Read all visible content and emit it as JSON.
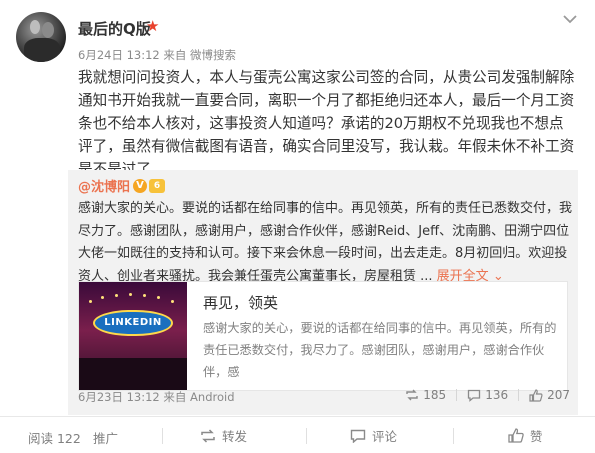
{
  "post": {
    "author": "最后的Q版",
    "vip_badge": "★",
    "meta": "6月24日 13:12 来自 微博搜索",
    "text": "我就想问问投资人，本人与蛋壳公寓这家公司签的合同，从贵公司发强制解除通知书开始我就一直要合同，离职一个月了都拒绝归还本人，最后一个月工资条也不给本人核对，这事投资人知道吗？承诺的20万期权不兑现我也不想点评了，虽然有微信截图有语音，确实合同里没写，我认栽。年假未休不补工资是不是过了"
  },
  "repost": {
    "author": "@沈博阳",
    "badge_v": "V",
    "badge_level": "6",
    "text": "感谢大家的关心。要说的话都在给同事的信中。再见领英，所有的责任已悉数交付，我尽力了。感谢团队，感谢用户，感谢合作伙伴，感谢Reid、Jeff、沈南鹏、田溯宁四位大佬一如既往的支持和认可。接下来会休息一段时间，出去走走。8月初回归。欢迎投资人、创业者来骚扰。我会兼任蛋壳公寓董事长，房屋租赁 ...",
    "expand_label": "展开全文",
    "expand_icon": "⌄",
    "card": {
      "image_text": "LINKEDIN",
      "title": "再见，领英",
      "desc": "感谢大家的关心，要说的话都在给同事的信中。再见领英，所有的责任已悉数交付，我尽力了。感谢团队，感谢用户，感谢合作伙伴，感"
    },
    "time": "6月23日 13:12 来自 Android",
    "reposts": "185",
    "comments": "136",
    "likes": "207"
  },
  "actions": {
    "reads": "阅读 122",
    "promote": "推广",
    "repost": "转发",
    "comment": "评论",
    "like": "赞"
  },
  "colors": {
    "accent": "#eb7350",
    "vip_star": "#e8412c",
    "repost_bg": "#f2f2f2"
  },
  "icons": [
    "chevron-down-icon",
    "vip-star-icon",
    "verified-v-icon",
    "level-badge-icon",
    "repost-icon",
    "comment-icon",
    "like-icon"
  ]
}
